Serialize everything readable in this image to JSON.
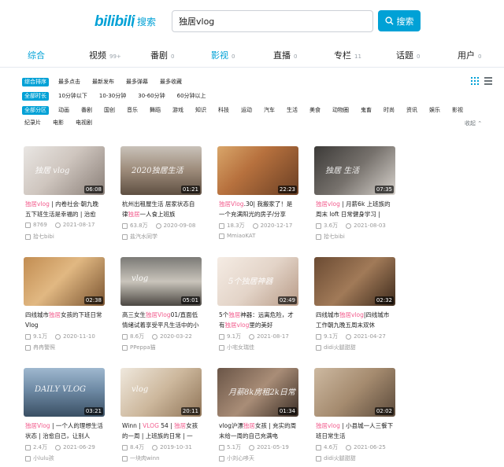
{
  "header": {
    "logo_text": "bilibili",
    "logo_sub": "搜索",
    "search_value": "独居vlog",
    "search_button": "搜索",
    "accent": "#00a1d6"
  },
  "tabs": [
    {
      "label": "综合",
      "count": ""
    },
    {
      "label": "视频",
      "count": "99+"
    },
    {
      "label": "番剧",
      "count": "0"
    },
    {
      "label": "影视",
      "count": "0"
    },
    {
      "label": "直播",
      "count": "0"
    },
    {
      "label": "专栏",
      "count": "11"
    },
    {
      "label": "话题",
      "count": "0"
    },
    {
      "label": "用户",
      "count": "0"
    }
  ],
  "filters": {
    "order": [
      "综合排序",
      "最多点击",
      "最新发布",
      "最多弹幕",
      "最多收藏"
    ],
    "duration": [
      "全部时长",
      "10分钟以下",
      "10-30分钟",
      "30-60分钟",
      "60分钟以上"
    ],
    "zones_row1": [
      "全部分区",
      "动画",
      "番剧",
      "国创",
      "音乐",
      "舞蹈",
      "游戏",
      "知识",
      "科技",
      "运动",
      "汽车",
      "生活",
      "美食",
      "动物圈",
      "鬼畜",
      "时尚",
      "资讯",
      "娱乐",
      "影视"
    ],
    "zones_row2": [
      "纪录片",
      "电影",
      "电视剧"
    ],
    "collapse_label": "收起"
  },
  "videos": [
    {
      "pre": "",
      "hl": "独居vlog",
      "post": " | 内卷社会·朝九晚五下班生活是幸福的 | 治愈",
      "duration": "06:08",
      "views": "8769",
      "date": "2021-08-17",
      "uploader": "拾七bibi"
    },
    {
      "pre": "杭州出租屋生活 居家状态自律",
      "hl": "独居",
      "post": "一人食上班族",
      "duration": "01:21",
      "views": "63.8万",
      "date": "2020-09-08",
      "uploader": "盐汽水同学"
    },
    {
      "pre": "",
      "hl": "独居Vlog",
      "post": ".30| 我搬家了！是一个充满阳光的房子/分享",
      "duration": "22:23",
      "views": "18.3万",
      "date": "2020-12-17",
      "uploader": "MmiaoKAT"
    },
    {
      "pre": "",
      "hl": "独居vlog",
      "post": " | 月薪6k 上班族的周末 loft 日常健身学习 |",
      "duration": "07:35",
      "views": "3.6万",
      "date": "2021-08-03",
      "uploader": "拾七bibi"
    },
    {
      "pre": "四线城市",
      "hl": "独居",
      "post": "女孩的下班日常Vlog",
      "duration": "02:38",
      "views": "9.1万",
      "date": "2020-11-10",
      "uploader": "冉冉警照"
    },
    {
      "pre": "高三女生",
      "hl": "独居Vlog",
      "post": "01/直面低情绪试着享受平凡生活中的小",
      "duration": "05:01",
      "views": "8.6万",
      "date": "2020-03-22",
      "uploader": "PPeppa猫"
    },
    {
      "pre": "5个",
      "hl": "独居",
      "post": "神器：远离危险，才有",
      "hl2": "独居vlog",
      "post2": "里的美好",
      "duration": "02:49",
      "views": "9.1万",
      "date": "2021-08-17",
      "uploader": "小宅女瑞佳"
    },
    {
      "pre": "四线城市",
      "hl": "独居vlog",
      "post": "|四线城市工作朝九晚五周末双休",
      "duration": "02:32",
      "views": "9.1万",
      "date": "2021-04-27",
      "uploader": "didi火腿甜甜"
    },
    {
      "pre": "",
      "hl": "独居Vlog",
      "post": " | 一个人的理想生活状态 | 治愈自己，让别人",
      "duration": "03:21",
      "views": "2.4万",
      "date": "2021-06-29",
      "uploader": "小lulu孩"
    },
    {
      "pre": "Winn | ",
      "hl": "VLOG",
      "post": " 54 | ",
      "hl2": "独居",
      "post2": "女孩的一周 | 上班族的日常 | 一",
      "duration": "20:11",
      "views": "8.4万",
      "date": "2019-10-31",
      "uploader": "一块肉winn"
    },
    {
      "pre": "vlog沪漂",
      "hl": "独居",
      "post": "女孩 | 充实的周末给一周的自己充满电",
      "duration": "01:34",
      "views": "5.1万",
      "date": "2021-05-19",
      "uploader": "小刘心哆天"
    },
    {
      "pre": "",
      "hl": "独居vlog",
      "post": " | 小县城一人三餐下班日常生活",
      "duration": "02:02",
      "views": "4.6万",
      "date": "2021-06-25",
      "uploader": "didi火腿甜甜"
    }
  ],
  "thumb_overlays": [
    "独居 vlog",
    "2020独居生活",
    "",
    "独居 生活",
    "",
    "vlog",
    "5个独居神器",
    "",
    "DAILY VLOG",
    "vlog",
    "月薪8k房租2k日常",
    ""
  ],
  "colors": {
    "highlight": "#f25d8e",
    "muted": "#999999"
  }
}
